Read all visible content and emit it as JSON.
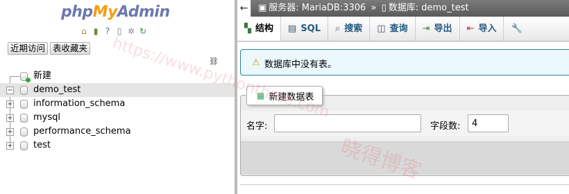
{
  "app": {
    "logo_php": "php",
    "logo_my": "My",
    "logo_admin": "Admin"
  },
  "nav": {
    "icons": [
      "home-icon",
      "logout-icon",
      "help-icon",
      "docs-icon",
      "settings-icon",
      "reload-icon"
    ],
    "tabs": [
      "近期访问",
      "表收藏夹"
    ],
    "tree": [
      {
        "label": "新建",
        "type": "new"
      },
      {
        "label": "demo_test",
        "selected": true,
        "expander": "−"
      },
      {
        "label": "information_schema",
        "expander": "+"
      },
      {
        "label": "mysql",
        "expander": "+"
      },
      {
        "label": "performance_schema",
        "expander": "+"
      },
      {
        "label": "test",
        "expander": "+"
      }
    ]
  },
  "topbar": {
    "server_label": "服务器: MariaDB:3306",
    "sep": "»",
    "db_label": "数据库: demo_test"
  },
  "tabs": [
    {
      "label": "结构",
      "icon": "structure-icon",
      "active": true
    },
    {
      "label": "SQL",
      "icon": "sql-icon"
    },
    {
      "label": "搜索",
      "icon": "search-icon"
    },
    {
      "label": "查询",
      "icon": "query-icon"
    },
    {
      "label": "导出",
      "icon": "export-icon"
    },
    {
      "label": "导入",
      "icon": "import-icon"
    },
    {
      "label": "",
      "icon": "wrench-icon"
    }
  ],
  "notice": {
    "message": "数据库中没有表。"
  },
  "create_table": {
    "legend": "新建数据表",
    "name_label": "名字:",
    "name_value": "",
    "columns_label": "字段数:",
    "columns_value": "4"
  },
  "watermark": {
    "url": "https://www.pythonthree.com",
    "text": "晓得博客"
  },
  "colors": {
    "accent": "#235a81",
    "notice_bg": "#ebf8fd",
    "notice_border": "#2a7ea1"
  }
}
